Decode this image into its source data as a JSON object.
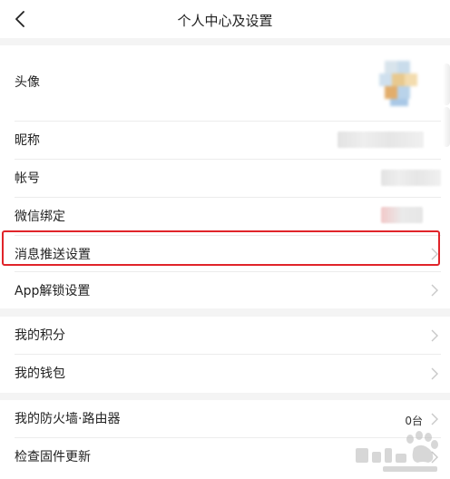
{
  "header": {
    "title": "个人中心及设置",
    "back_icon": "chevron-left-icon"
  },
  "profile": {
    "avatar_label": "头像",
    "nickname_label": "昵称",
    "account_label": "帐号",
    "wechat_label": "微信绑定",
    "push_label": "消息推送设置",
    "unlock_label": "App解锁设置"
  },
  "wallet": {
    "points_label": "我的积分",
    "wallet_label": "我的钱包"
  },
  "device": {
    "firewall_label": "我的防火墙·路由器",
    "firewall_count": "0台",
    "firmware_label": "检查固件更新"
  },
  "colors": {
    "highlight": "#e0242a",
    "background": "#f4f4f4"
  }
}
